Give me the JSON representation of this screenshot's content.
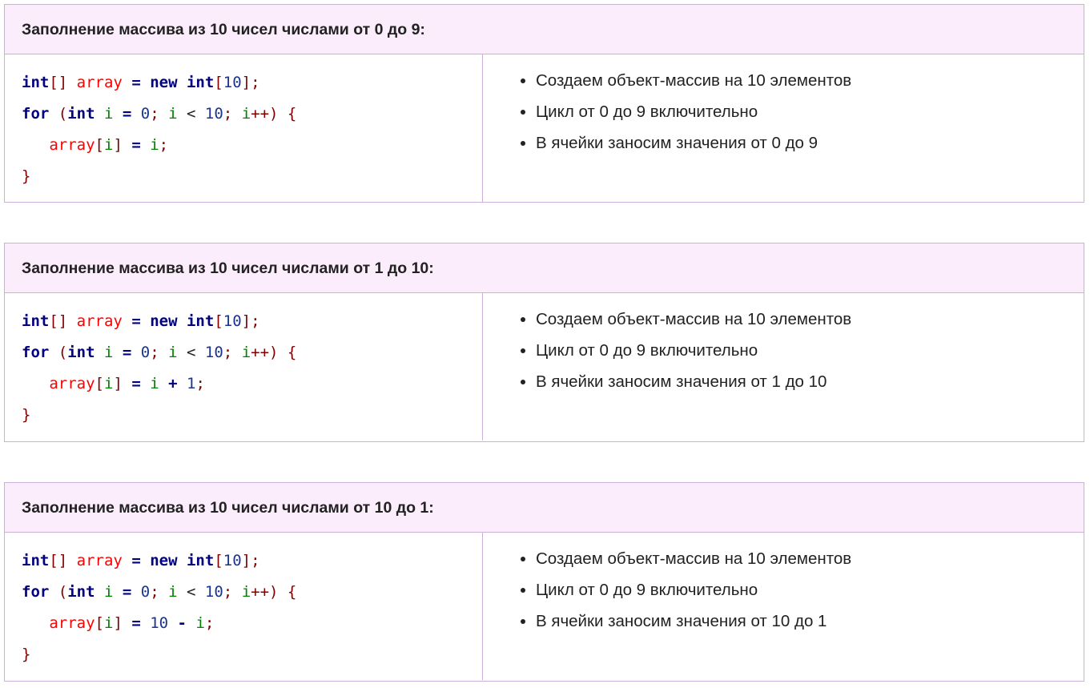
{
  "blocks": [
    {
      "title": "Заполнение массива из 10 чисел числами от 0 до 9:",
      "code": [
        [
          [
            "int",
            "kw"
          ],
          [
            "[]",
            "br"
          ],
          [
            " ",
            "pl"
          ],
          [
            "array",
            "var"
          ],
          [
            " = ",
            "op"
          ],
          [
            "new",
            "kw"
          ],
          [
            " ",
            "pl"
          ],
          [
            "int",
            "kw"
          ],
          [
            "[",
            "br"
          ],
          [
            "10",
            "num"
          ],
          [
            "];",
            "br"
          ]
        ],
        [
          [
            "for",
            "kw"
          ],
          [
            " (",
            "br"
          ],
          [
            "int",
            "kw"
          ],
          [
            " ",
            "pl"
          ],
          [
            "i",
            "idx"
          ],
          [
            " = ",
            "op"
          ],
          [
            "0",
            "num"
          ],
          [
            "; ",
            "br"
          ],
          [
            "i",
            "idx"
          ],
          [
            " < ",
            "pl"
          ],
          [
            "10",
            "num"
          ],
          [
            "; ",
            "br"
          ],
          [
            "i",
            "idx"
          ],
          [
            "++) {",
            "br"
          ]
        ],
        [
          [
            "   ",
            "pl"
          ],
          [
            "array",
            "var"
          ],
          [
            "[",
            "br"
          ],
          [
            "i",
            "idx"
          ],
          [
            "]",
            "br"
          ],
          [
            " = ",
            "op"
          ],
          [
            "i",
            "idx"
          ],
          [
            ";",
            "br"
          ]
        ],
        [
          [
            "}",
            "br"
          ]
        ]
      ],
      "notes": [
        "Создаем объект-массив на 10 элементов",
        "Цикл от 0 до 9 включительно",
        "В ячейки заносим значения от 0 до 9"
      ]
    },
    {
      "title": "Заполнение массива из 10 чисел числами от 1 до 10:",
      "code": [
        [
          [
            "int",
            "kw"
          ],
          [
            "[]",
            "br"
          ],
          [
            " ",
            "pl"
          ],
          [
            "array",
            "var"
          ],
          [
            " = ",
            "op"
          ],
          [
            "new",
            "kw"
          ],
          [
            " ",
            "pl"
          ],
          [
            "int",
            "kw"
          ],
          [
            "[",
            "br"
          ],
          [
            "10",
            "num"
          ],
          [
            "];",
            "br"
          ]
        ],
        [
          [
            "for",
            "kw"
          ],
          [
            " (",
            "br"
          ],
          [
            "int",
            "kw"
          ],
          [
            " ",
            "pl"
          ],
          [
            "i",
            "idx"
          ],
          [
            " = ",
            "op"
          ],
          [
            "0",
            "num"
          ],
          [
            "; ",
            "br"
          ],
          [
            "i",
            "idx"
          ],
          [
            " < ",
            "pl"
          ],
          [
            "10",
            "num"
          ],
          [
            "; ",
            "br"
          ],
          [
            "i",
            "idx"
          ],
          [
            "++) {",
            "br"
          ]
        ],
        [
          [
            "   ",
            "pl"
          ],
          [
            "array",
            "var"
          ],
          [
            "[",
            "br"
          ],
          [
            "i",
            "idx"
          ],
          [
            "]",
            "br"
          ],
          [
            " = ",
            "op"
          ],
          [
            "i",
            "idx"
          ],
          [
            " + ",
            "op"
          ],
          [
            "1",
            "num"
          ],
          [
            ";",
            "br"
          ]
        ],
        [
          [
            "}",
            "br"
          ]
        ]
      ],
      "notes": [
        "Создаем объект-массив на 10 элементов",
        "Цикл от 0 до 9 включительно",
        "В ячейки заносим значения от 1 до 10"
      ]
    },
    {
      "title": "Заполнение массива из 10 чисел числами от 10 до 1:",
      "code": [
        [
          [
            "int",
            "kw"
          ],
          [
            "[]",
            "br"
          ],
          [
            " ",
            "pl"
          ],
          [
            "array",
            "var"
          ],
          [
            " = ",
            "op"
          ],
          [
            "new",
            "kw"
          ],
          [
            " ",
            "pl"
          ],
          [
            "int",
            "kw"
          ],
          [
            "[",
            "br"
          ],
          [
            "10",
            "num"
          ],
          [
            "];",
            "br"
          ]
        ],
        [
          [
            "for",
            "kw"
          ],
          [
            " (",
            "br"
          ],
          [
            "int",
            "kw"
          ],
          [
            " ",
            "pl"
          ],
          [
            "i",
            "idx"
          ],
          [
            " = ",
            "op"
          ],
          [
            "0",
            "num"
          ],
          [
            "; ",
            "br"
          ],
          [
            "i",
            "idx"
          ],
          [
            " < ",
            "pl"
          ],
          [
            "10",
            "num"
          ],
          [
            "; ",
            "br"
          ],
          [
            "i",
            "idx"
          ],
          [
            "++) {",
            "br"
          ]
        ],
        [
          [
            "   ",
            "pl"
          ],
          [
            "array",
            "var"
          ],
          [
            "[",
            "br"
          ],
          [
            "i",
            "idx"
          ],
          [
            "]",
            "br"
          ],
          [
            " = ",
            "op"
          ],
          [
            "10",
            "num"
          ],
          [
            " - ",
            "op"
          ],
          [
            "i",
            "idx"
          ],
          [
            ";",
            "br"
          ]
        ],
        [
          [
            "}",
            "br"
          ]
        ]
      ],
      "notes": [
        "Создаем объект-массив на 10 элементов",
        "Цикл от 0 до 9 включительно",
        "В ячейки заносим значения от 10 до 1"
      ]
    }
  ]
}
